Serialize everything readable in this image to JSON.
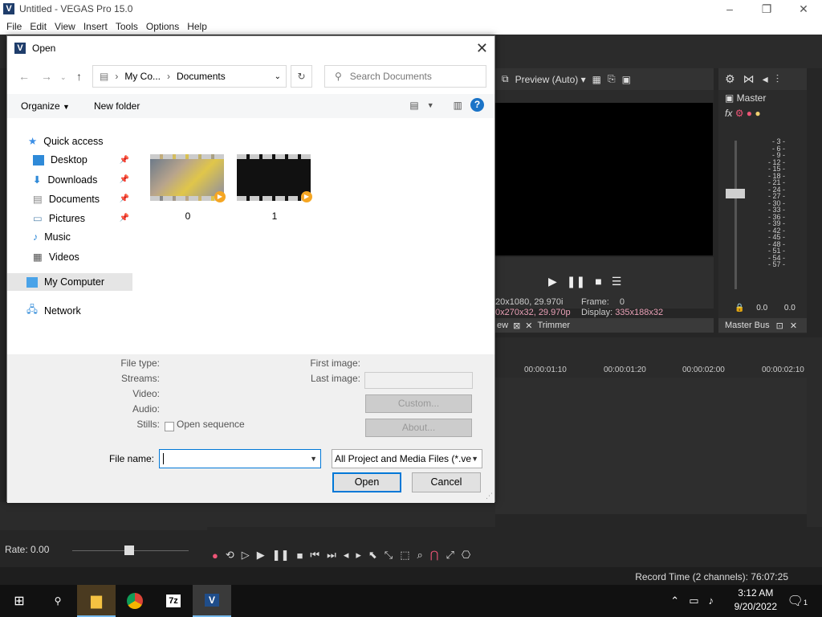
{
  "app": {
    "title": "Untitled - VEGAS Pro 15.0",
    "logo_letter": "V",
    "window_controls": [
      "–",
      "❐",
      "✕"
    ]
  },
  "menubar": [
    "File",
    "Edit",
    "View",
    "Insert",
    "Tools",
    "Options",
    "Help"
  ],
  "preview": {
    "mode": "Preview (Auto)",
    "info_left_1": "20x1080, 29.970i",
    "info_left_2": "0x270x32, 29.970p",
    "frame_label": "Frame:",
    "frame_value": "0",
    "display_label": "Display:",
    "display_value": "335x188x32",
    "tab_left": "ew",
    "tab_trimmer": "Trimmer"
  },
  "master": {
    "label": "Master",
    "bus_tab": "Master Bus",
    "db_scale": [
      "3",
      "6",
      "9",
      "12",
      "15",
      "18",
      "21",
      "24",
      "27",
      "30",
      "33",
      "36",
      "39",
      "42",
      "45",
      "48",
      "51",
      "54",
      "57"
    ],
    "meter_left": "0.0",
    "meter_right": "0.0"
  },
  "timeline": {
    "ruler": [
      "00:00:01:10",
      "00:00:01:20",
      "00:00:02:00",
      "00:00:02:10"
    ]
  },
  "rate": {
    "label": "Rate: 0.00"
  },
  "status": {
    "record_time": "Record Time (2 channels): 76:07:25"
  },
  "taskbar": {
    "time": "3:12 AM",
    "date": "9/20/2022",
    "notif_count": "1"
  },
  "dialog": {
    "title": "Open",
    "breadcrumb": [
      "My Co...",
      "Documents"
    ],
    "search_placeholder": "Search Documents",
    "organize": "Organize",
    "new_folder": "New folder",
    "nav": [
      {
        "label": "Quick access"
      },
      {
        "label": "Desktop"
      },
      {
        "label": "Downloads"
      },
      {
        "label": "Documents"
      },
      {
        "label": "Pictures"
      },
      {
        "label": "Music"
      },
      {
        "label": "Videos"
      },
      {
        "label": "My Computer"
      },
      {
        "label": "Network"
      }
    ],
    "files": [
      {
        "name": "0"
      },
      {
        "name": "1"
      }
    ],
    "props": {
      "file_type": "File type:",
      "streams": "Streams:",
      "video": "Video:",
      "audio": "Audio:",
      "stills": "Stills:",
      "open_sequence": "Open sequence",
      "first_image": "First image:",
      "last_image": "Last image:",
      "custom": "Custom...",
      "about": "About..."
    },
    "file_name_label": "File name:",
    "file_name_value": "",
    "file_type_filter": "All Project and Media Files (*.ve",
    "open_button": "Open",
    "cancel_button": "Cancel"
  }
}
